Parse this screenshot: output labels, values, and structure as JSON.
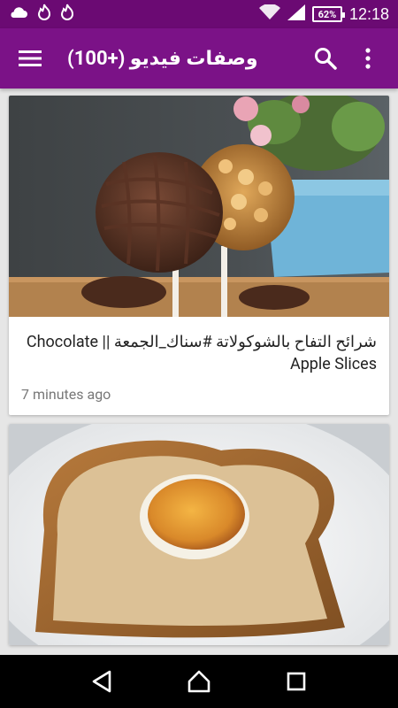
{
  "status_bar": {
    "time": "12:18",
    "battery": "62%"
  },
  "app_bar": {
    "title": "وصفات فيديو (+100)",
    "color": "#7b1287"
  },
  "feed": [
    {
      "title": "شرائح التفاح بالشوكولاتة #سناك_الجمعة || Chocolate Apple Slices",
      "time": "7 minutes ago",
      "image": "chocolate-apple-lollipops"
    },
    {
      "title": "",
      "time": "",
      "image": "egg-in-toast"
    }
  ],
  "nav": {
    "back": "back-icon",
    "home": "home-icon",
    "recents": "recents-icon"
  }
}
